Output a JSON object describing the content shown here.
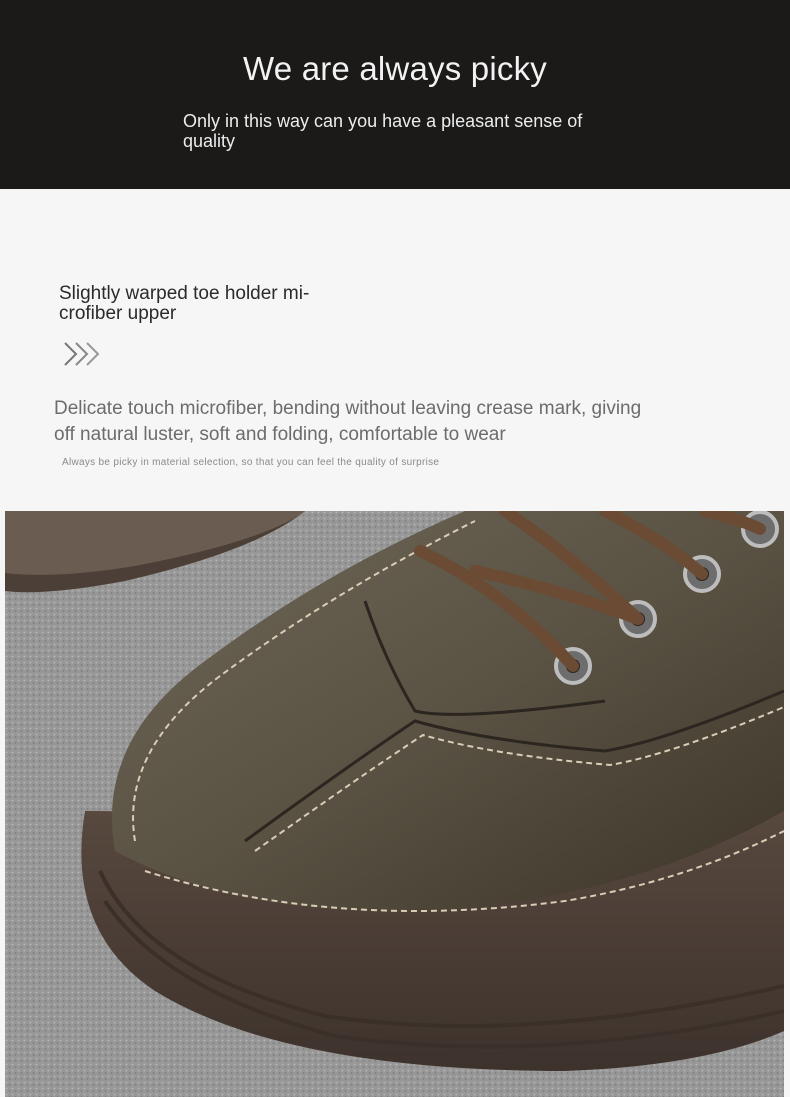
{
  "hero": {
    "title": "We are always picky",
    "subtitle": "Only in this way can you have a pleasant sense of quality"
  },
  "feature": {
    "title": "Slightly warped toe holder mi-crofiber upper",
    "arrow_icon": "triple-chevron-right-icon",
    "description": "Delicate touch microfiber, bending without leaving crease mark, giving off natural luster, soft and folding, comfortable to wear",
    "note": "Always be picky in material selection, so that you can feel the quality of surprise"
  },
  "photo": {
    "subject": "shoe-toe-closeup",
    "colors": {
      "leather": "#5e5646",
      "sole": "#4a3c35",
      "carpet": "#9a9a9a",
      "lace": "#6b4b33"
    }
  }
}
